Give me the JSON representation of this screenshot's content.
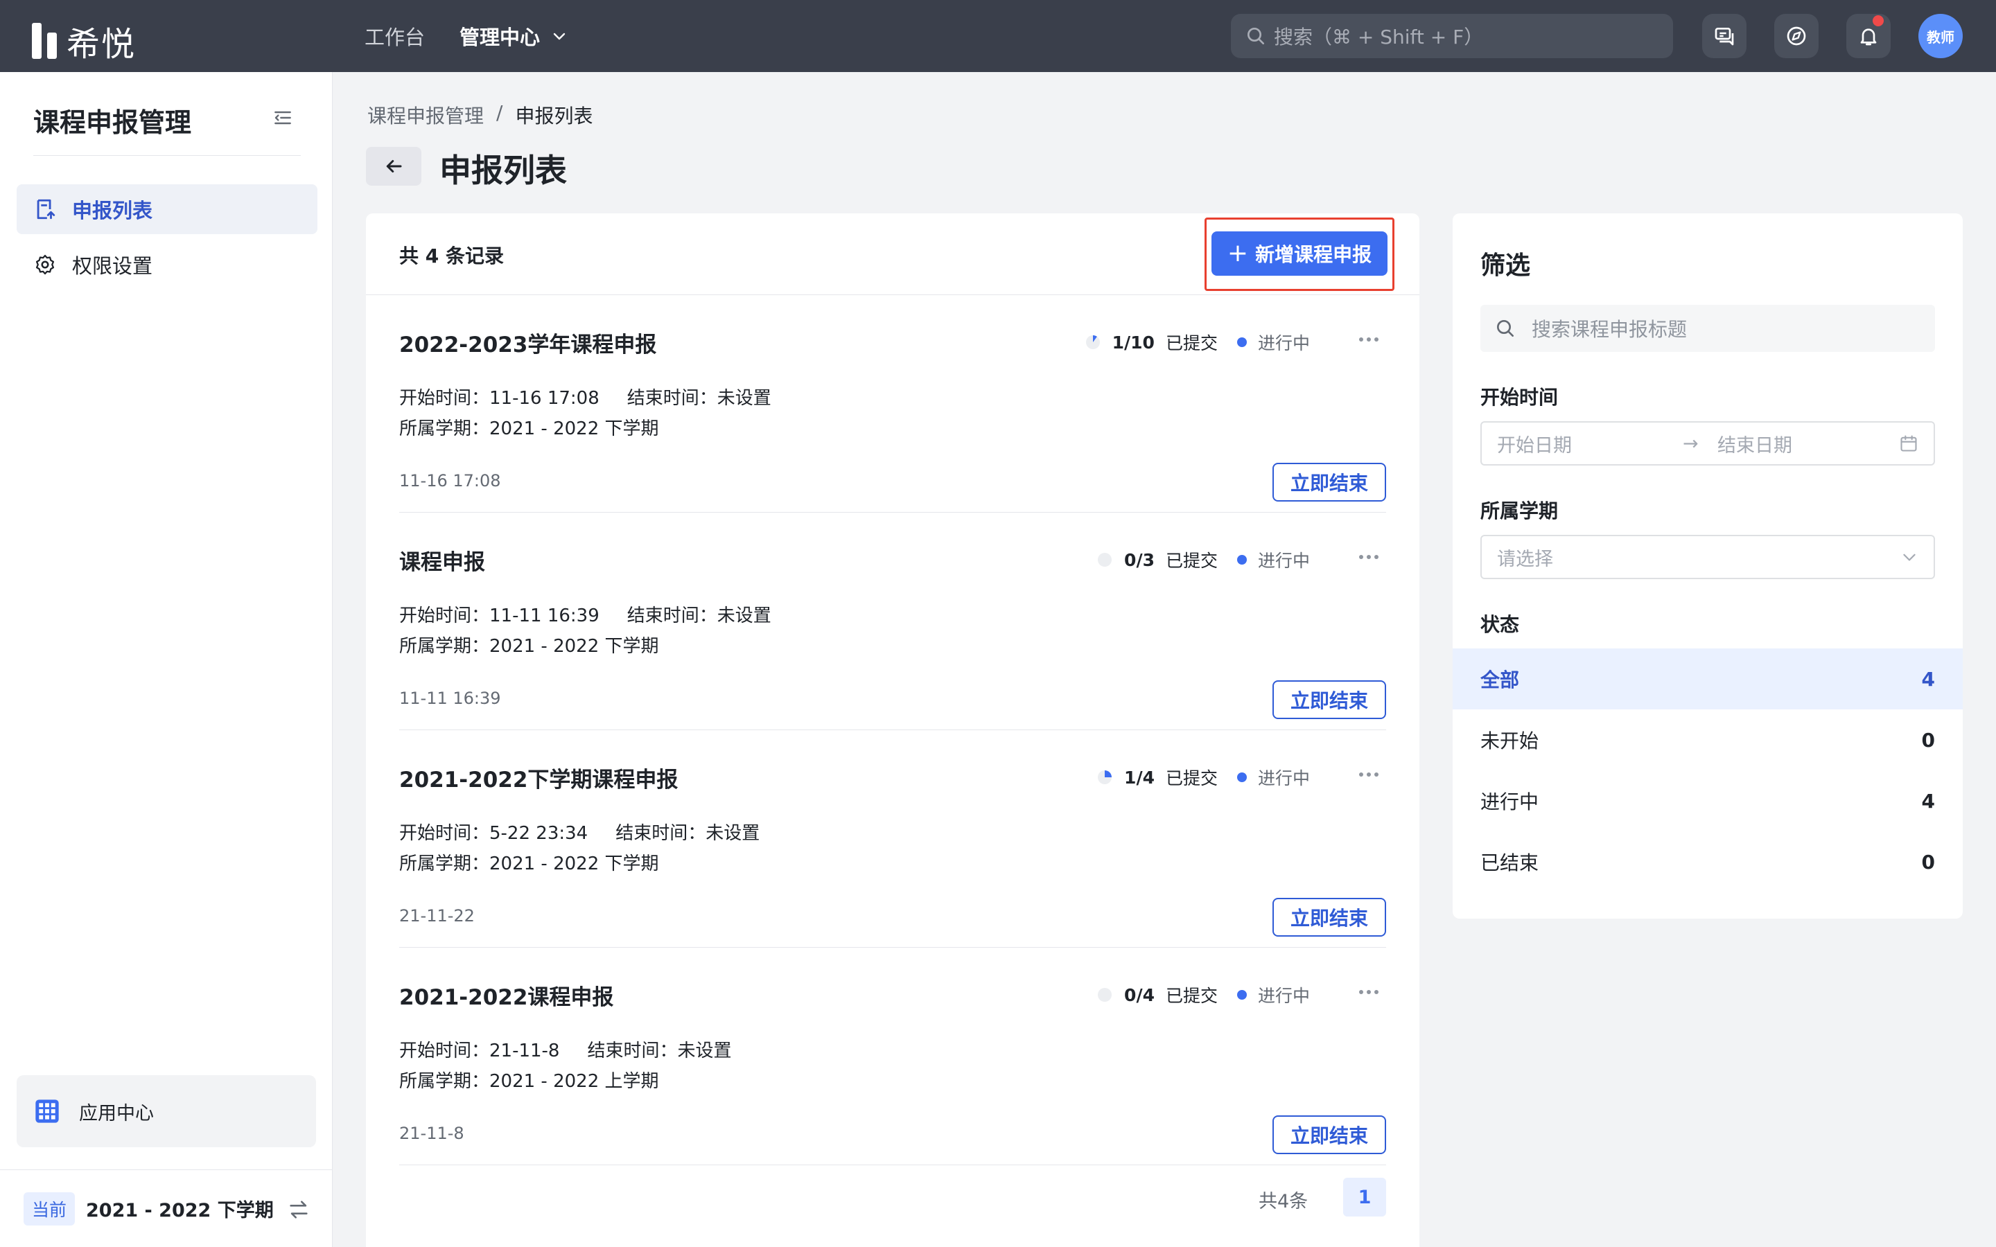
{
  "app": {
    "logo_text": "希悦",
    "nav": [
      {
        "label": "工作台"
      },
      {
        "label": "管理中心"
      }
    ],
    "search_placeholder": "搜索（⌘ + Shift + F）",
    "avatar_text": "教师",
    "icons": [
      "chat-icon",
      "compass-icon",
      "bell-icon"
    ]
  },
  "sidebar": {
    "title": "课程申报管理",
    "items": [
      {
        "label": "申报列表",
        "icon": "list-upload-icon",
        "active": true
      },
      {
        "label": "权限设置",
        "icon": "gear-icon",
        "active": false
      }
    ],
    "app_center": "应用中心",
    "term_tag": "当前",
    "term_label": "2021 - 2022 下学期"
  },
  "main": {
    "breadcrumb": [
      "课程申报管理",
      "/",
      "申报列表"
    ],
    "title": "申报列表",
    "record_count": "共 4 条记录",
    "add_button": "新增课程申报",
    "cards": [
      {
        "title": "2022-2023学年课程申报",
        "progress": "1/10",
        "progress_fraction": 0.1,
        "submitted_label": "已提交",
        "status": "进行中",
        "start": "开始时间：11-16 17:08",
        "end": "结束时间：未设置",
        "term": "所属学期：2021 - 2022 下学期",
        "date": "11-16 17:08",
        "end_button": "立即结束"
      },
      {
        "title": "课程申报",
        "progress": "0/3",
        "progress_fraction": 0,
        "submitted_label": "已提交",
        "status": "进行中",
        "start": "开始时间：11-11 16:39",
        "end": "结束时间：未设置",
        "term": "所属学期：2021 - 2022 下学期",
        "date": "11-11 16:39",
        "end_button": "立即结束"
      },
      {
        "title": "2021-2022下学期课程申报",
        "progress": "1/4",
        "progress_fraction": 0.25,
        "submitted_label": "已提交",
        "status": "进行中",
        "start": "开始时间：5-22 23:34",
        "end": "结束时间：未设置",
        "term": "所属学期：2021 - 2022 下学期",
        "date": "21-11-22",
        "end_button": "立即结束"
      },
      {
        "title": "2021-2022课程申报",
        "progress": "0/4",
        "progress_fraction": 0,
        "submitted_label": "已提交",
        "status": "进行中",
        "start": "开始时间：21-11-8",
        "end": "结束时间：未设置",
        "term": "所属学期：2021 - 2022 上学期",
        "date": "21-11-8",
        "end_button": "立即结束"
      }
    ],
    "pager_total": "共4条",
    "pager_page": "1"
  },
  "filter": {
    "title": "筛选",
    "search_placeholder": "搜索课程申报标题",
    "start_label": "开始时间",
    "date_start_placeholder": "开始日期",
    "date_arrow": "→",
    "date_end_placeholder": "结束日期",
    "term_label": "所属学期",
    "term_placeholder": "请选择",
    "status_label": "状态",
    "statuses": [
      {
        "name": "全部",
        "count": "4",
        "active": true
      },
      {
        "name": "未开始",
        "count": "0",
        "active": false
      },
      {
        "name": "进行中",
        "count": "4",
        "active": false
      },
      {
        "name": "已结束",
        "count": "0",
        "active": false
      }
    ]
  },
  "colors": {
    "topbar": "#3a3f4b",
    "primary": "#3c6df0",
    "highlight_frame": "#e8402f"
  }
}
